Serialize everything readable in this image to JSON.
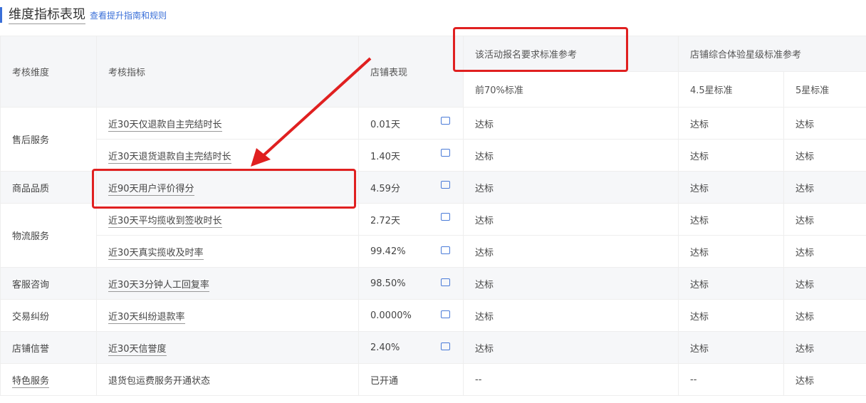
{
  "header": {
    "title": "维度指标表现",
    "link": "查看提升指南和规则"
  },
  "table": {
    "col_dimension": "考核维度",
    "col_metric": "考核指标",
    "col_performance": "店铺表现",
    "col_activity": "该活动报名要求标准参考",
    "col_star": "店铺综合体验星级标准参考",
    "sub_top70": "前70%标准",
    "sub_45": "4.5星标准",
    "sub_5": "5星标准",
    "rows": [
      {
        "dimension": "售后服务",
        "metric": "近30天仅退款自主完结时长",
        "value": "0.01天",
        "a": "达标",
        "b": "达标",
        "c": "达标"
      },
      {
        "dimension": "",
        "metric": "近30天退货退款自主完结时长",
        "value": "1.40天",
        "a": "达标",
        "b": "达标",
        "c": "达标"
      },
      {
        "dimension": "商品品质",
        "metric": "近90天用户评价得分",
        "value": "4.59分",
        "a": "达标",
        "b": "达标",
        "c": "达标"
      },
      {
        "dimension": "物流服务",
        "metric": "近30天平均揽收到签收时长",
        "value": "2.72天",
        "a": "达标",
        "b": "达标",
        "c": "达标"
      },
      {
        "dimension": "",
        "metric": "近30天真实揽收及时率",
        "value": "99.42%",
        "a": "达标",
        "b": "达标",
        "c": "达标"
      },
      {
        "dimension": "客服咨询",
        "metric": "近30天3分钟人工回复率",
        "value": "98.50%",
        "a": "达标",
        "b": "达标",
        "c": "达标"
      },
      {
        "dimension": "交易纠纷",
        "metric": "近30天纠纷退款率",
        "value": "0.0000%",
        "a": "达标",
        "b": "达标",
        "c": "达标"
      },
      {
        "dimension": "店铺信誉",
        "metric": "近30天信誉度",
        "value": "2.40%",
        "a": "达标",
        "b": "达标",
        "c": "达标"
      },
      {
        "dimension": "特色服务",
        "metric": "退货包运费服务开通状态",
        "value": "已开通",
        "a": "--",
        "b": "--",
        "c": "达标"
      }
    ]
  }
}
